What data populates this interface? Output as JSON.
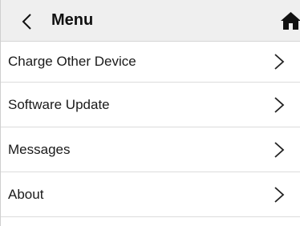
{
  "header": {
    "back_icon": "chevron-left-icon",
    "title": "Menu",
    "home_icon": "home-icon"
  },
  "menu": {
    "items": [
      {
        "label": "Charge Other Device",
        "icon": "chevron-right-icon"
      },
      {
        "label": "Software Update",
        "icon": "chevron-right-icon"
      },
      {
        "label": "Messages",
        "icon": "chevron-right-icon"
      },
      {
        "label": "About",
        "icon": "chevron-right-icon"
      }
    ]
  },
  "colors": {
    "header_background": "#efefef",
    "divider": "#dcdcdc",
    "text": "#1a1a1a"
  }
}
